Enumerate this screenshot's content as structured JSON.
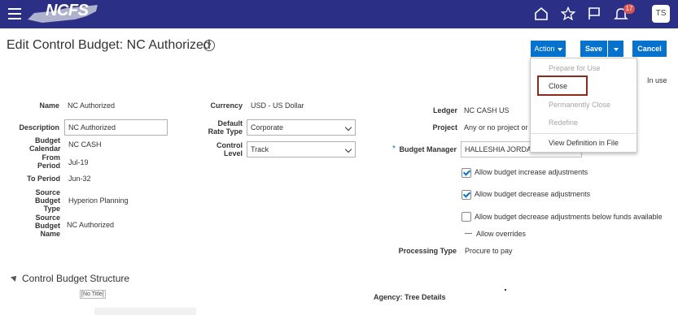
{
  "header": {
    "logo_text": "NCFS",
    "notification_count": "17",
    "user_initials": "TS",
    "bar_color": "#2b2f86"
  },
  "page": {
    "title": "Edit Control Budget: NC Authorized",
    "help_icon": "?"
  },
  "toolbar": {
    "action_label": "Action",
    "save_label": "Save",
    "cancel_label": "Cancel"
  },
  "action_menu": {
    "items": [
      {
        "label": "Prepare for Use",
        "enabled": false
      },
      {
        "label": "Close",
        "enabled": true
      },
      {
        "label": "Permanently Close",
        "enabled": false
      },
      {
        "label": "Redefine",
        "enabled": false
      },
      {
        "label": "View Definition in File",
        "enabled": true
      }
    ]
  },
  "status": {
    "fragment": "s",
    "value": "In use"
  },
  "form": {
    "name_label": "Name",
    "name_value": "NC Authorized",
    "description_label": "Description",
    "description_value": "NC Authorized",
    "budget_calendar_label": "Budget Calendar",
    "budget_calendar_value": "NC CASH",
    "from_period_label": "From Period",
    "from_period_value": "Jul-19",
    "to_period_label": "To Period",
    "to_period_value": "Jun-32",
    "source_budget_type_label": "Source Budget Type",
    "source_budget_type_value": "Hyperion Planning",
    "source_budget_name_label": "Source Budget Name",
    "source_budget_name_value": "NC Authorized",
    "currency_label": "Currency",
    "currency_value": "USD - US Dollar",
    "default_rate_type_label": "Default Rate Type",
    "default_rate_type_value": "Corporate",
    "control_level_label": "Control Level",
    "control_level_value": "Track",
    "ledger_label": "Ledger",
    "ledger_value": "NC CASH US",
    "project_label": "Project",
    "project_value": "Any or no project or",
    "budget_manager_label": "Budget Manager",
    "budget_manager_required": "*",
    "budget_manager_value": "HALLESHIA JORDA",
    "processing_type_label": "Processing Type",
    "processing_type_value": "Procure to pay"
  },
  "options": {
    "allow_increase": {
      "label": "Allow budget increase adjustments",
      "checked": true
    },
    "allow_decrease": {
      "label": "Allow budget decrease adjustments",
      "checked": true
    },
    "allow_decrease_below": {
      "label": "Allow budget decrease adjustments below funds available",
      "checked": false
    },
    "allow_overrides": {
      "label": "Allow overrides"
    }
  },
  "structure": {
    "title": "Control Budget Structure",
    "no_title": "[No Title]",
    "agency_tree": "Agency: Tree Details"
  }
}
